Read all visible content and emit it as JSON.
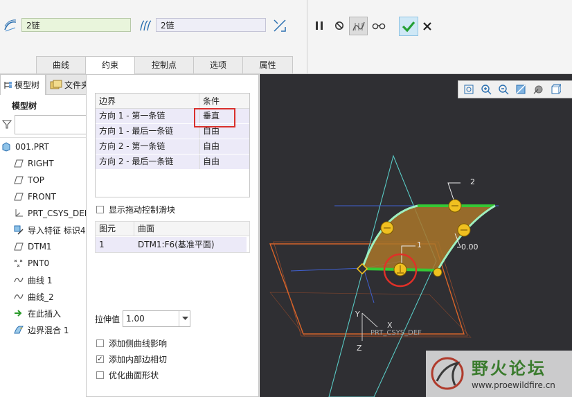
{
  "ribbon": {
    "chain1_value": "2链",
    "chain2_value": "2链",
    "tabs": [
      "曲线",
      "约束",
      "控制点",
      "选项",
      "属性"
    ]
  },
  "left_panel": {
    "tab_model_tree": "模型树",
    "tab_file": "文件夹",
    "heading": "模型树",
    "items": [
      {
        "label": "001.PRT",
        "icon": "part-icon"
      },
      {
        "label": "RIGHT",
        "icon": "datum-plane-icon"
      },
      {
        "label": "TOP",
        "icon": "datum-plane-icon"
      },
      {
        "label": "FRONT",
        "icon": "datum-plane-icon"
      },
      {
        "label": "PRT_CSYS_DEF",
        "icon": "csys-icon"
      },
      {
        "label": "导入特征 标识4",
        "icon": "import-feature-icon"
      },
      {
        "label": "DTM1",
        "icon": "datum-plane-icon"
      },
      {
        "label": "PNT0",
        "icon": "datum-point-icon"
      },
      {
        "label": "曲线 1",
        "icon": "curve-icon"
      },
      {
        "label": "曲线_2",
        "icon": "curve-icon"
      },
      {
        "label": "在此插入",
        "icon": "insert-here-icon"
      },
      {
        "label": "边界混合 1",
        "icon": "boundary-blend-icon"
      }
    ]
  },
  "constraints": {
    "header_boundary": "边界",
    "header_condition": "条件",
    "rows": [
      {
        "boundary": "方向 1 - 第一条链",
        "condition": "垂直"
      },
      {
        "boundary": "方向 1 - 最后一条链",
        "condition": "自由"
      },
      {
        "boundary": "方向 2 - 第一条链",
        "condition": "自由"
      },
      {
        "boundary": "方向 2 - 最后一条链",
        "condition": "自由"
      }
    ],
    "show_drag_handles": "显示拖动控制滑块",
    "sub_header_element": "图元",
    "sub_header_surface": "曲面",
    "sub_rows": [
      {
        "element": "1",
        "surface": "DTM1:F6(基准平面)"
      }
    ],
    "stretch_label": "拉伸值",
    "stretch_value": "1.00",
    "opt_side_curves": "添加侧曲线影响",
    "opt_inner_edge": "添加内部边相切",
    "opt_optimize": "优化曲面形状"
  },
  "graphics": {
    "label_2": "2",
    "label_1": "1",
    "label_value": "0.00",
    "axis_y": "Y",
    "axis_x": "X",
    "axis_z": "Z",
    "csys_label": "PRT_CSYS_DEF"
  },
  "watermark": {
    "title": "野火论坛",
    "url": "www.proewildfire.cn"
  },
  "colors": {
    "accent_green": "#3cb43c",
    "highlight_red": "#d9302c",
    "handle_yellow": "#f0c020"
  }
}
